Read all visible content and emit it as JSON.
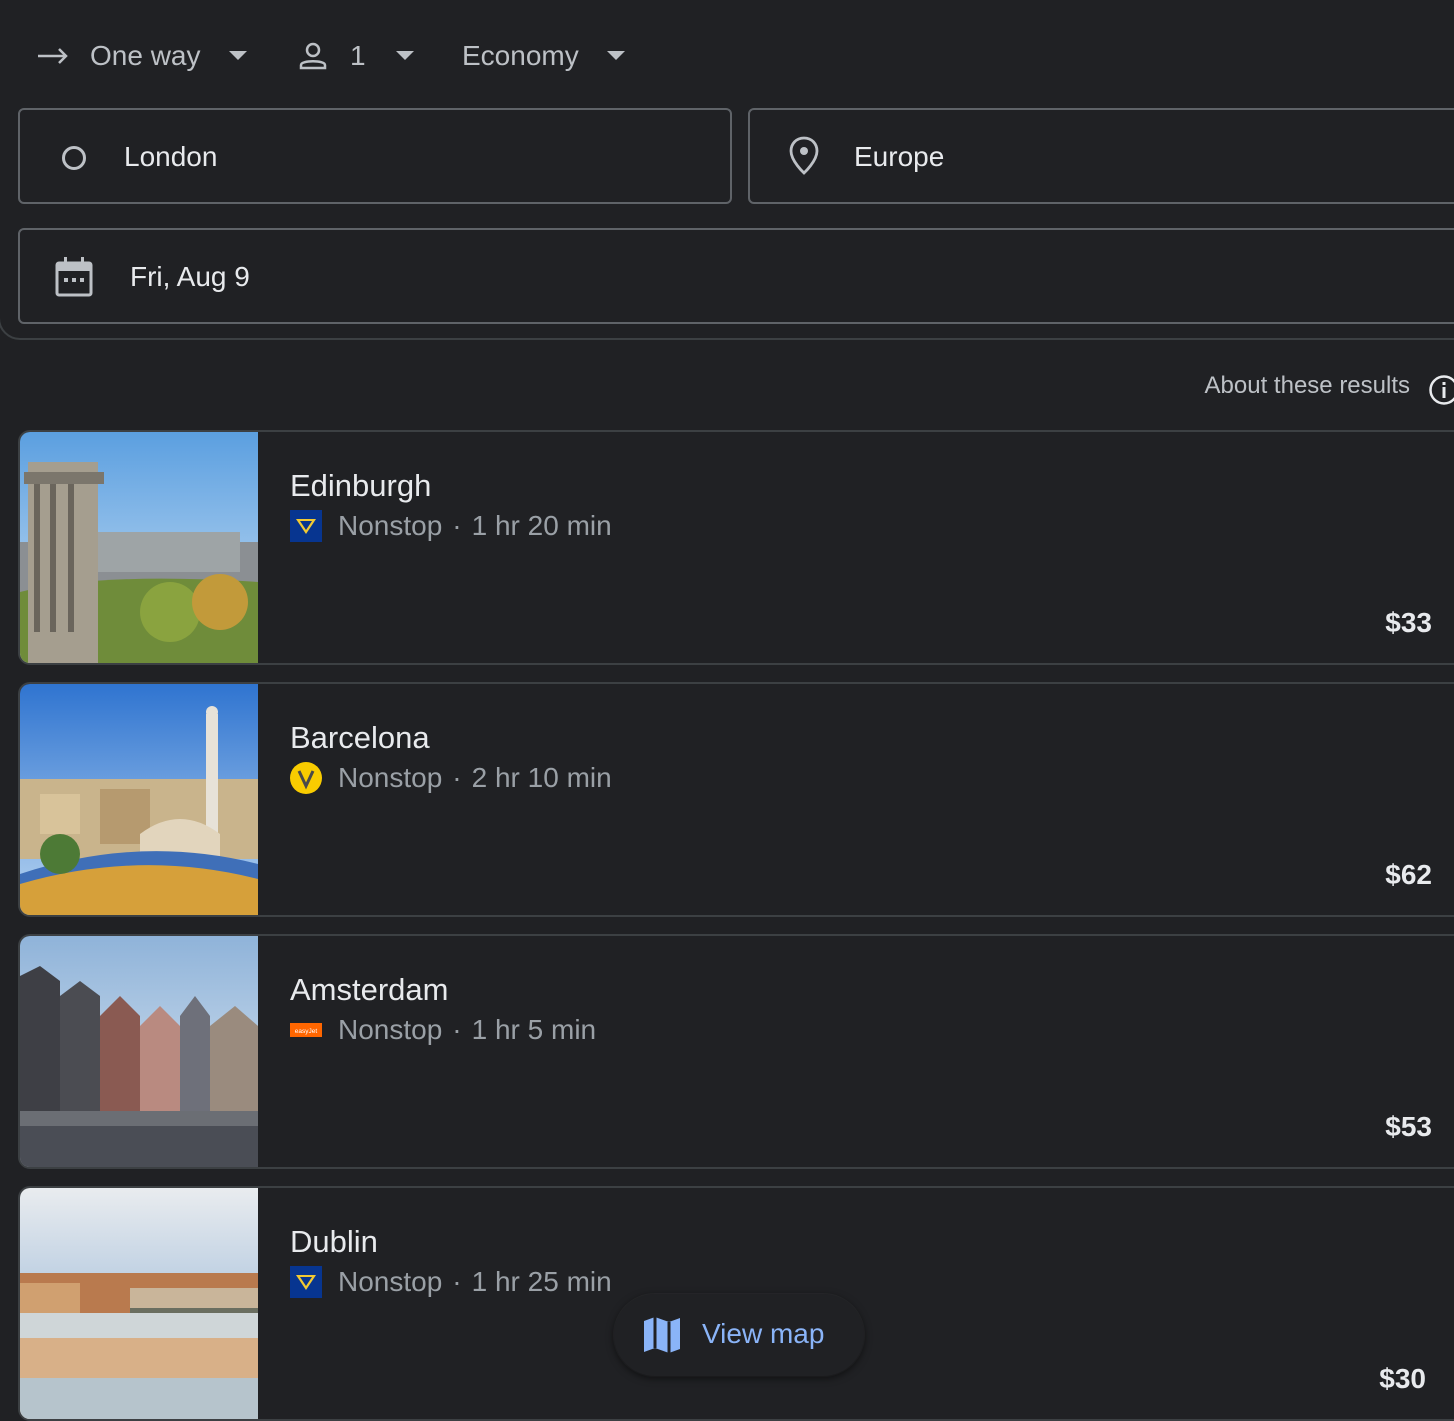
{
  "search": {
    "trip_type": "One way",
    "passengers": "1",
    "cabin_class": "Economy",
    "origin": "London",
    "destination": "Europe",
    "date": "Fri, Aug 9"
  },
  "results_header": {
    "about_label": "About these results"
  },
  "results": [
    {
      "city": "Edinburgh",
      "airline_logo": "ryanair-logo",
      "stops": "Nonstop",
      "duration": "1 hr 20 min",
      "price": "$33"
    },
    {
      "city": "Barcelona",
      "airline_logo": "vueling-logo",
      "stops": "Nonstop",
      "duration": "2 hr 10 min",
      "price": "$62"
    },
    {
      "city": "Amsterdam",
      "airline_logo": "easyjet-logo",
      "airline_logo_text": "easyJet",
      "stops": "Nonstop",
      "duration": "1 hr 5 min",
      "price": "$53"
    },
    {
      "city": "Dublin",
      "airline_logo": "ryanair-logo",
      "stops": "Nonstop",
      "duration": "1 hr 25 min",
      "price": "$30"
    }
  ],
  "map_button": {
    "label": "View map"
  },
  "colors": {
    "background": "#202124",
    "border": "#3c4043",
    "accent": "#8ab4f8",
    "text": "#e8eaed",
    "muted": "#9aa0a6"
  }
}
